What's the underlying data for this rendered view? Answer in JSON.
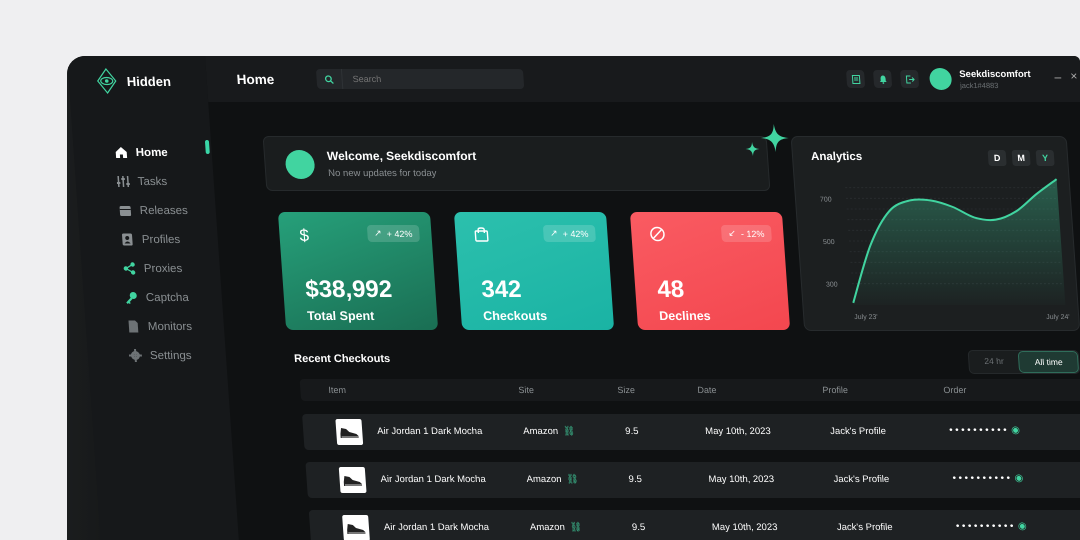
{
  "brand": {
    "name": "Hidden"
  },
  "nav": [
    {
      "label": "Home",
      "icon": "home-icon",
      "active": true
    },
    {
      "label": "Tasks",
      "icon": "sliders-icon"
    },
    {
      "label": "Releases",
      "icon": "calendar-icon"
    },
    {
      "label": "Profiles",
      "icon": "profile-icon"
    },
    {
      "label": "Proxies",
      "icon": "share-icon"
    },
    {
      "label": "Captcha",
      "icon": "key-icon"
    },
    {
      "label": "Monitors",
      "icon": "document-icon"
    },
    {
      "label": "Settings",
      "icon": "gear-icon"
    }
  ],
  "topbar": {
    "title": "Home",
    "search_placeholder": "Search",
    "user": {
      "name": "Seekdiscomfort",
      "tag": "jack1#4883"
    },
    "minimize": "–",
    "close": "×"
  },
  "welcome": {
    "title": "Welcome, Seekdiscomfort",
    "subtitle": "No new updates for today"
  },
  "stats": [
    {
      "symbol": "$",
      "change": "+ 42%",
      "value": "$38,992",
      "label": "Total Spent",
      "color": "#1f8a66"
    },
    {
      "symbol": "bag",
      "change": "+ 42%",
      "value": "342",
      "label": "Checkouts",
      "color": "#22bdaa"
    },
    {
      "symbol": "ban",
      "change": "- 12%",
      "value": "48",
      "label": "Declines",
      "color": "#f5505a"
    }
  ],
  "analytics": {
    "title": "Analytics",
    "ranges": [
      "D",
      "M",
      "Y"
    ],
    "active_range": "Y"
  },
  "chart_data": {
    "type": "area",
    "title": "Analytics",
    "x_ticks": [
      "July 23'",
      "July 24'"
    ],
    "y_ticks": [
      700,
      500,
      300
    ],
    "ylim": [
      200,
      800
    ],
    "x": [
      0,
      0.1,
      0.2,
      0.3,
      0.4,
      0.5,
      0.6,
      0.7,
      0.8,
      0.9,
      1.0
    ],
    "values": [
      210,
      480,
      640,
      690,
      690,
      660,
      610,
      600,
      640,
      720,
      790
    ],
    "grid": true,
    "color": "#41d4a0"
  },
  "recent": {
    "title": "Recent Checkouts",
    "filters": [
      "24 hr",
      "All time"
    ],
    "active_filter": "All time",
    "columns": [
      "Item",
      "Site",
      "Size",
      "Date",
      "Profile",
      "Order"
    ],
    "rows": [
      {
        "item": "Air Jordan 1 Dark Mocha",
        "site": "Amazon",
        "size": "9.5",
        "date": "May 10th, 2023",
        "profile": "Jack's Profile",
        "order": "••••••••••"
      },
      {
        "item": "Air Jordan 1 Dark Mocha",
        "site": "Amazon",
        "size": "9.5",
        "date": "May 10th, 2023",
        "profile": "Jack's Profile",
        "order": "••••••••••"
      },
      {
        "item": "Air Jordan 1 Dark Mocha",
        "site": "Amazon",
        "size": "9.5",
        "date": "May 10th, 2023",
        "profile": "Jack's Profile",
        "order": "••••••••••"
      }
    ]
  },
  "colors": {
    "accent": "#41d4a0",
    "background": "#0f1112",
    "danger": "#f5505a"
  }
}
